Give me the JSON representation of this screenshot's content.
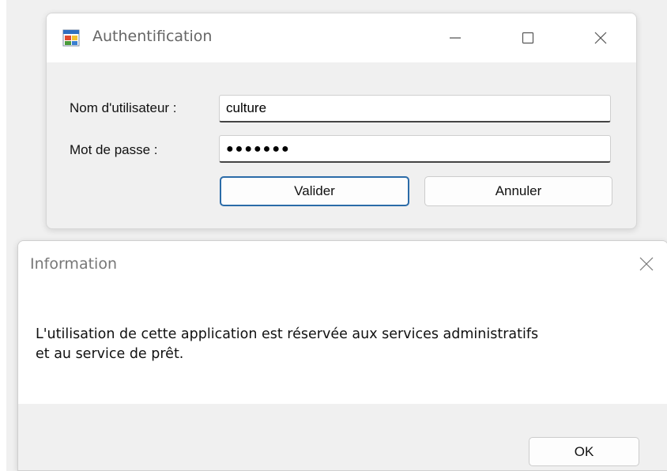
{
  "login_window": {
    "title": "Authentification",
    "username_label": "Nom d'utilisateur :",
    "username_value": "culture",
    "password_label": "Mot de passe :",
    "password_display": "●●●●●●●",
    "validate_label": "Valider",
    "cancel_label": "Annuler"
  },
  "info_dialog": {
    "title": "Information",
    "message_line1": "L'utilisation de cette application est réservée aux services administratifs",
    "message_line2": "et au service de prêt.",
    "ok_label": "OK"
  },
  "colors": {
    "accent_border": "#2b6ba8",
    "window_bg": "#f0f0f0",
    "titlebar_bg": "#ffffff"
  },
  "icons": [
    "app-form-icon",
    "minimize-icon",
    "maximize-icon",
    "close-icon"
  ]
}
